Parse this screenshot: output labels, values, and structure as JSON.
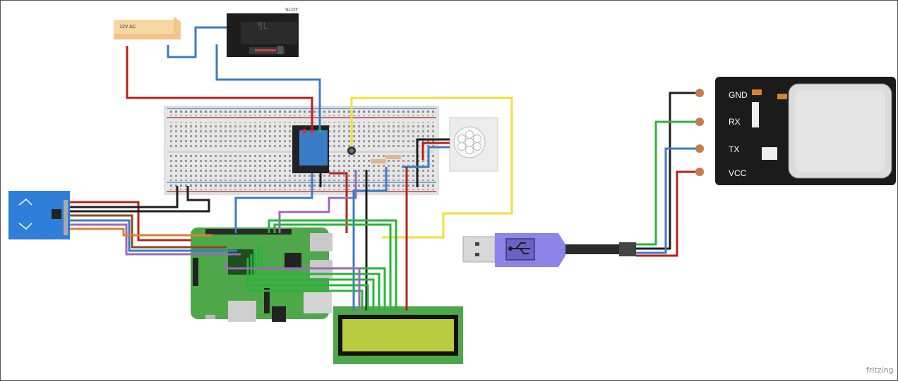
{
  "labels": {
    "ac_source": "12V AC",
    "solenoid": "SLOT",
    "fp_pin_gnd": "GND",
    "fp_pin_rx": "RX",
    "fp_pin_tx": "TX",
    "fp_pin_vcc": "VCC",
    "watermark": "fritzing"
  },
  "colors": {
    "wire_red": "#b8211a",
    "wire_blue": "#3a7bc8",
    "wire_black": "#1e1e1e",
    "wire_green": "#27b53a",
    "wire_yellow": "#f2df3a",
    "wire_purple": "#9a6ab8",
    "wire_brown": "#8a4a1c",
    "wire_orange": "#d9822b",
    "pi_board": "#4ea84a",
    "rfid_board": "#2f7fd8",
    "lcd_screen": "#b7cc3e",
    "usb_adapter": "#8c84e8"
  },
  "icons": {
    "usb_logo": "usb-icon",
    "pir_dome": "pir-dome-icon"
  }
}
